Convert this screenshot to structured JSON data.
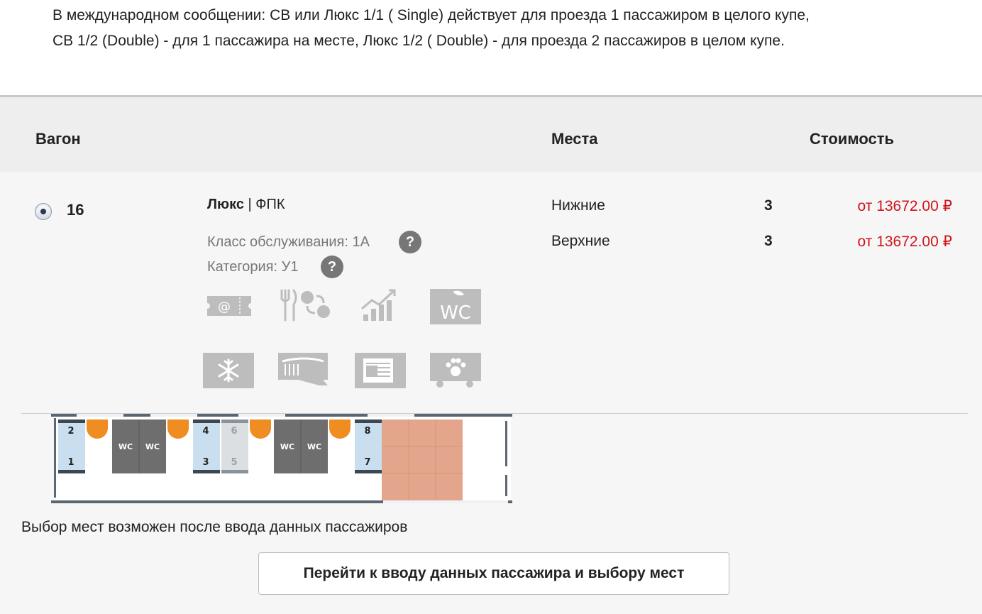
{
  "note": {
    "line1": "В международном сообщении: СВ или Люкс 1/1 ( Single) действует для проезда 1 пассажиром в целого купе,",
    "line2": "СВ 1/2 (Double) - для 1 пассажира на месте, Люкс 1/2 ( Double) - для проезда 2 пассажиров в целом купе."
  },
  "table_header": {
    "wagon": "Вагон",
    "seats": "Места",
    "cost": "Стоимость"
  },
  "wagon": {
    "number": "16",
    "selected": true,
    "type": "Люкс",
    "separator": " | ",
    "carrier": "ФПК",
    "service_class": "Класс обслуживания: 1А",
    "category": "Категория: У1",
    "help_glyph": "?",
    "services": [
      "e-ticket-icon",
      "meal-icon",
      "chart-icon",
      "wc-icon",
      "air-conditioning-icon",
      "hygiene-kit-icon",
      "press-icon",
      "pets-icon"
    ],
    "seats": [
      {
        "label": "Нижние",
        "count": "3",
        "price": "от 13672.00 ₽"
      },
      {
        "label": "Верхние",
        "count": "3",
        "price": "от 13672.00 ₽"
      }
    ],
    "scheme": {
      "seat_numbers": [
        "2",
        "1",
        "4",
        "3",
        "6",
        "5",
        "8",
        "7"
      ],
      "wc_label": "WC",
      "free_color": "#c9dff0",
      "taken_color": "#dcdfe2",
      "wc_color": "#6e6e6e",
      "table_color": "#ef8c22",
      "service_area_color": "#e3a68c"
    }
  },
  "hint": "Выбор мест возможен после ввода данных пассажиров",
  "button": "Перейти к вводу данных пассажира и выбору мест"
}
